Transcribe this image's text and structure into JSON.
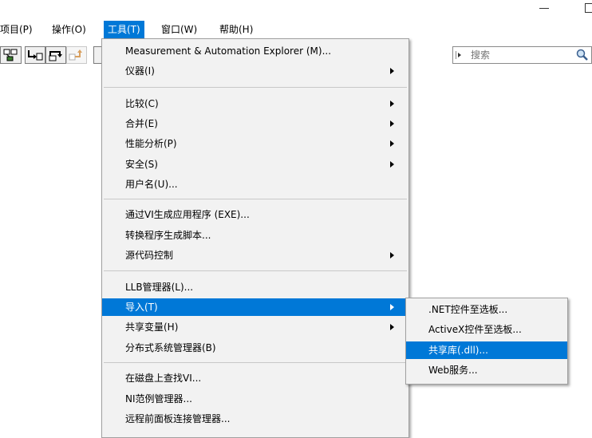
{
  "window": {
    "minimize_label": "–",
    "maximize_label": "□"
  },
  "menubar": {
    "items": [
      "项目(P)",
      "操作(O)",
      "工具(T)",
      "窗口(W)",
      "帮助(H)"
    ]
  },
  "search": {
    "placeholder": "搜索"
  },
  "tools_menu": {
    "items": [
      "Measurement & Automation Explorer (M)...",
      "仪器(I)",
      "比较(C)",
      "合并(E)",
      "性能分析(P)",
      "安全(S)",
      "用户名(U)...",
      "通过VI生成应用程序 (EXE)...",
      "转换程序生成脚本...",
      "源代码控制",
      "LLB管理器(L)...",
      "导入(T)",
      "共享变量(H)",
      "分布式系统管理器(B)",
      "在磁盘上查找VI...",
      "NI范例管理器...",
      "远程前面板连接管理器..."
    ]
  },
  "import_submenu": {
    "items": [
      ".NET控件至选板...",
      "ActiveX控件至选板...",
      "共享库(.dll)...",
      "Web服务..."
    ]
  },
  "colors": {
    "highlight": "#0078d7",
    "menu_bg": "#f2f2f2"
  }
}
